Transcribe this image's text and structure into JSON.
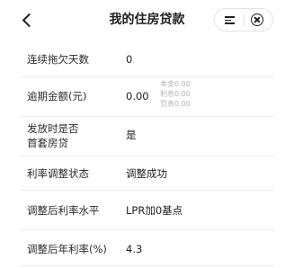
{
  "header": {
    "title": "我的住房贷款"
  },
  "rows": [
    {
      "label": "连续拖欠天数",
      "value": "0"
    },
    {
      "label": "逾期金额(元)",
      "value": "0.00",
      "breakdown": [
        "本金0.00",
        "利息0.00",
        "罚息0.00"
      ]
    },
    {
      "label_line1": "发放时是否",
      "label_line2": "首套房贷",
      "value": "是"
    },
    {
      "label": "利率调整状态",
      "value": "调整成功"
    },
    {
      "label": "调整后利率水平",
      "value": "LPR加0基点"
    },
    {
      "label": "调整后年利率(%)",
      "value": "4.3"
    }
  ]
}
